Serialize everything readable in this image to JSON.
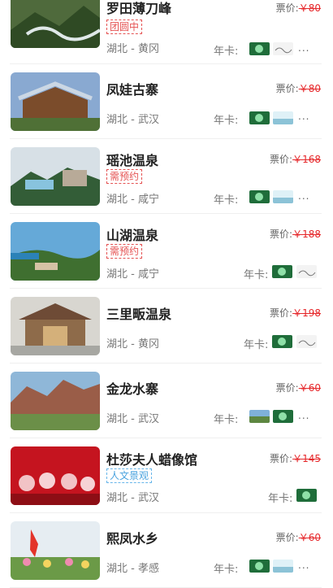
{
  "price_label": "票价:",
  "card_label": "年卡:",
  "more_label": "...",
  "items": [
    {
      "name": "罗田薄刀峰",
      "price": "￥80",
      "tag": "团圆中",
      "location": "湖北 - 黄冈"
    },
    {
      "name": "凤娃古寨",
      "price": "￥80",
      "tag": "",
      "location": "湖北 - 武汉"
    },
    {
      "name": "瑶池温泉",
      "price": "￥168",
      "tag": "需预约",
      "location": "湖北 - 咸宁"
    },
    {
      "name": "山湖温泉",
      "price": "￥188",
      "tag": "需预约",
      "location": "湖北 - 咸宁"
    },
    {
      "name": "三里畈温泉",
      "price": "￥198",
      "tag": "",
      "location": "湖北 - 黄冈"
    },
    {
      "name": "金龙水寨",
      "price": "￥60",
      "tag": "",
      "location": "湖北 - 武汉"
    },
    {
      "name": "杜莎夫人蜡像馆",
      "price": "￥145",
      "tag": "人文景观",
      "location": "湖北 - 武汉"
    },
    {
      "name": "熙凤水乡",
      "price": "￥60",
      "tag": "",
      "location": "湖北 - 孝感"
    }
  ],
  "colors": {
    "price_strike": "#e6282b",
    "tag_red": "#e55353",
    "tag_blue": "#4aa3df"
  }
}
